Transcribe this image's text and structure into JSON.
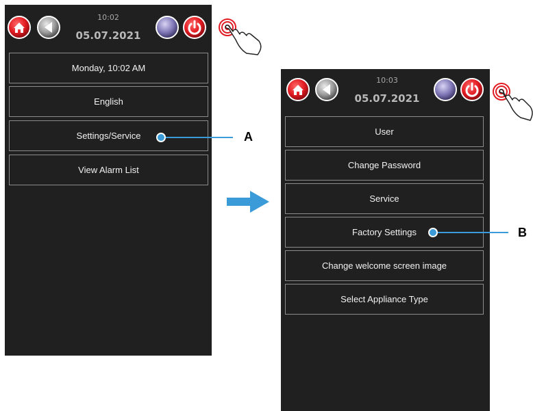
{
  "left_screen": {
    "time": "10:02",
    "date": "05.07.2021",
    "menu": [
      "Monday, 10:02 AM",
      "English",
      "Settings/Service",
      "View Alarm List"
    ]
  },
  "right_screen": {
    "time": "10:03",
    "date": "05.07.2021",
    "menu": [
      "User",
      "Change Password",
      "Service",
      "Factory Settings",
      "Change welcome screen image",
      "Select Appliance Type"
    ]
  },
  "callouts": {
    "a": "A",
    "b": "B"
  },
  "icons": {
    "home": "home-icon",
    "back": "back-arrow-icon",
    "night": "moon-icon",
    "power": "power-icon",
    "tap": "touch-gesture-icon",
    "transition": "right-arrow-icon"
  },
  "colors": {
    "panel": "#202020",
    "button_border": "#8c8c8c",
    "callout": "#3a9bd8",
    "home_red": "#e21b22",
    "transition_arrow": "#3a9bd8"
  }
}
